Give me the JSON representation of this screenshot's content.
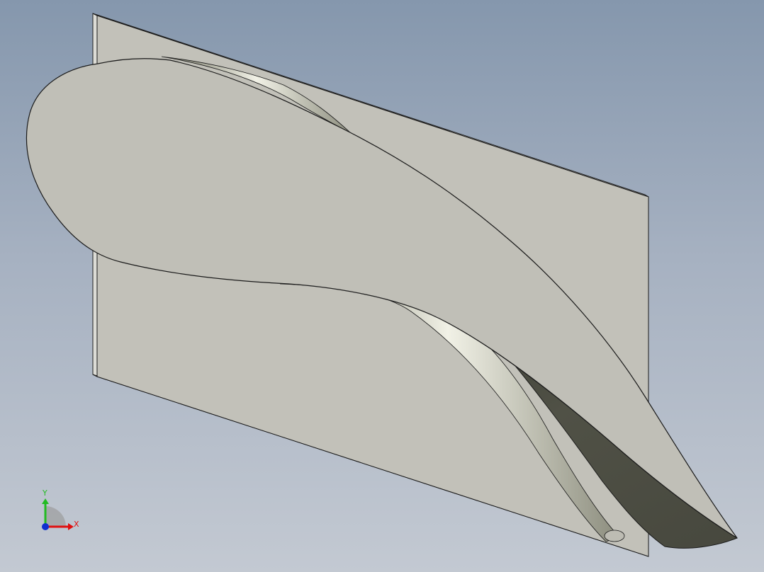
{
  "viewport": {
    "background_top": "#8597ad",
    "background_bottom": "#c3c9d2"
  },
  "model": {
    "plate_color": "#c2c1b9",
    "plate_edge_color": "#dcdcd6",
    "blade_face_color": "#c0bfb7",
    "blade_shadow_color": "#4a4b40",
    "edge_color": "#1a1a1a"
  },
  "triad": {
    "x_label": "X",
    "y_label": "Y",
    "x_color": "#e01010",
    "y_color": "#22bb22",
    "z_color": "#1030d0"
  }
}
